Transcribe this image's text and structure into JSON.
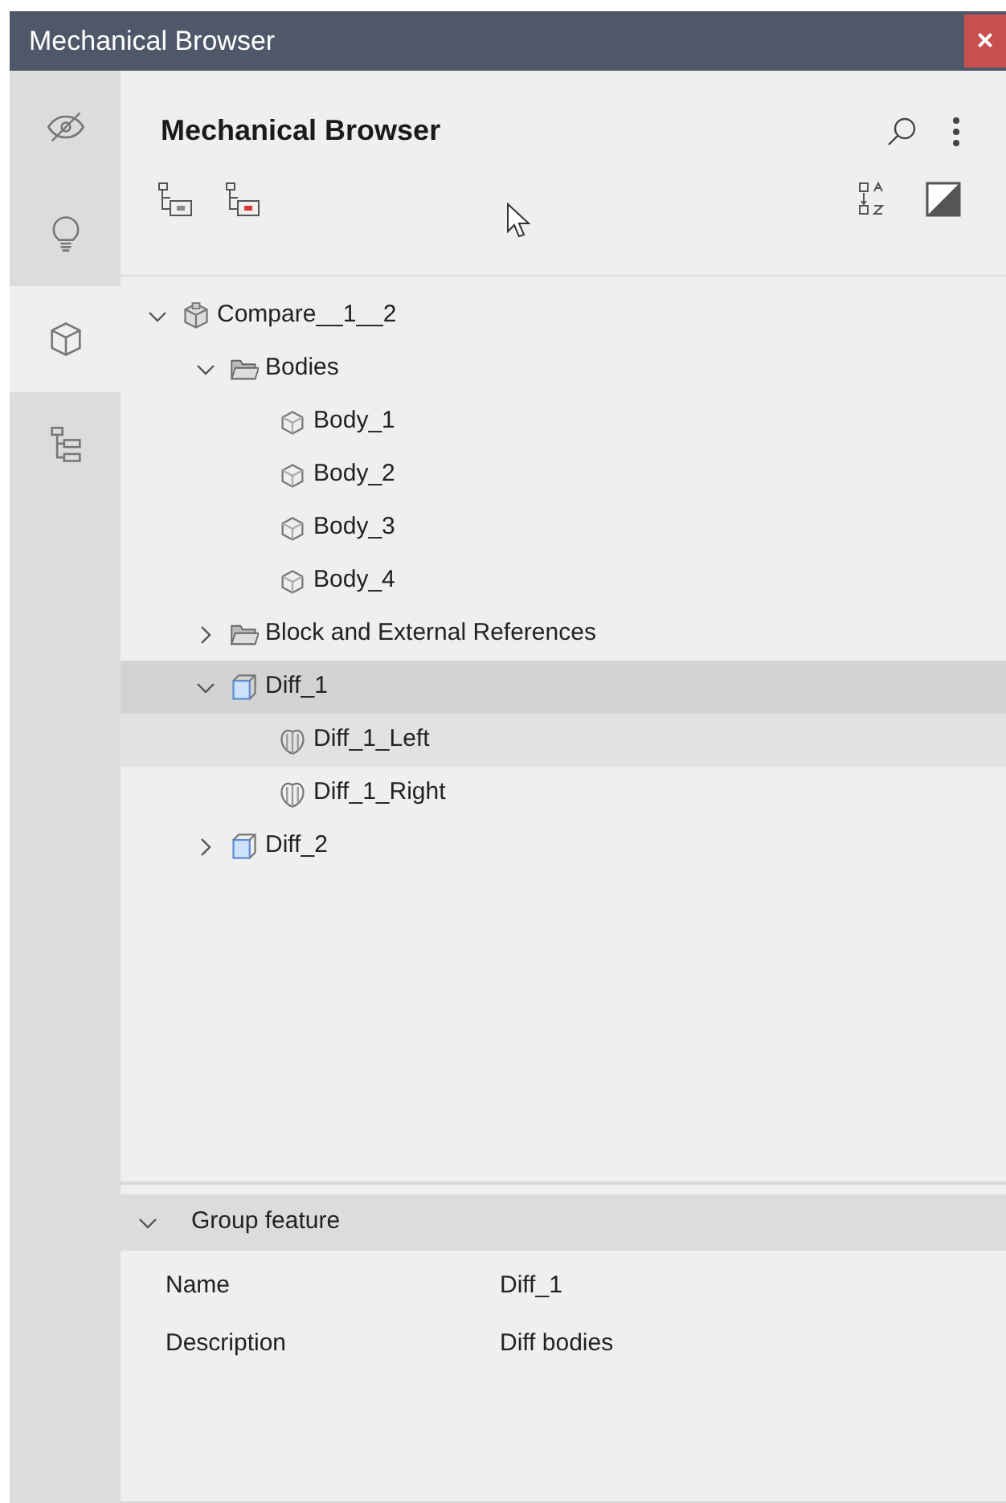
{
  "window": {
    "title": "Mechanical Browser",
    "close": "×"
  },
  "rail": [
    {
      "kind": "visibility",
      "selected": false
    },
    {
      "kind": "hint",
      "selected": false
    },
    {
      "kind": "cube",
      "selected": true
    },
    {
      "kind": "tree",
      "selected": false
    }
  ],
  "panel": {
    "title": "Mechanical Browser"
  },
  "tree": [
    {
      "label": "Compare__1__2",
      "kind": "assembly",
      "expanded": true,
      "selected": false,
      "hovered": false,
      "children": [
        {
          "label": "Bodies",
          "kind": "folder",
          "expanded": true,
          "selected": false,
          "hovered": false,
          "children": [
            {
              "label": "Body_1",
              "kind": "body",
              "selected": false,
              "hovered": false
            },
            {
              "label": "Body_2",
              "kind": "body",
              "selected": false,
              "hovered": false
            },
            {
              "label": "Body_3",
              "kind": "body",
              "selected": false,
              "hovered": false
            },
            {
              "label": "Body_4",
              "kind": "body",
              "selected": false,
              "hovered": false
            }
          ]
        },
        {
          "label": "Block and External References",
          "kind": "folder",
          "expanded": false,
          "selected": false,
          "hovered": false
        },
        {
          "label": "Diff_1",
          "kind": "diff",
          "expanded": true,
          "selected": true,
          "hovered": false,
          "children": [
            {
              "label": "Diff_1_Left",
              "kind": "half",
              "selected": false,
              "hovered": true
            },
            {
              "label": "Diff_1_Right",
              "kind": "half",
              "selected": false,
              "hovered": false
            }
          ]
        },
        {
          "label": "Diff_2",
          "kind": "diff",
          "expanded": false,
          "selected": false,
          "hovered": false
        }
      ]
    }
  ],
  "properties": {
    "group": "Group feature",
    "expanded": true,
    "rows": [
      {
        "name": "Name",
        "value": "Diff_1"
      },
      {
        "name": "Description",
        "value": "Diff bodies"
      }
    ]
  }
}
